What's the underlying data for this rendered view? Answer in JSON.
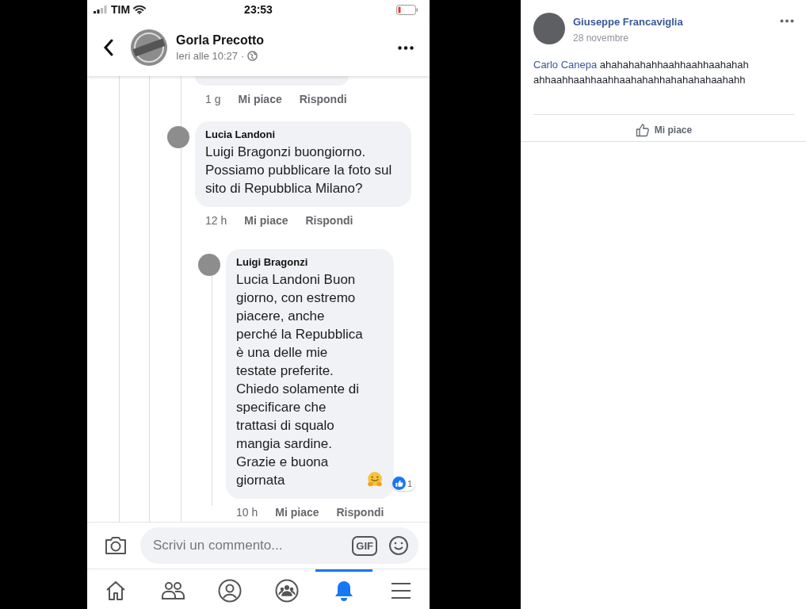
{
  "status_bar": {
    "carrier": "TIM",
    "time": "23:53"
  },
  "header": {
    "title": "Gorla Precotto",
    "subtitle": "Ieri alle 10:27 ·"
  },
  "comments": [
    {
      "kind": "cut",
      "time": "1 g",
      "like": "Mi piace",
      "reply": "Rispondi"
    },
    {
      "kind": "full",
      "author": "Lucia Landoni",
      "text": "Luigi Bragonzi buongiorno. Possiamo pubblicare la foto sul sito di Repubblica Milano?",
      "time": "12 h",
      "like": "Mi piace",
      "reply": "Rispondi",
      "children": [
        {
          "kind": "full",
          "author": "Luigi Bragonzi",
          "text": "Lucia Landoni  Buon giorno, con estremo piacere, anche perché la Repubblica è una delle mie testate preferite. Chiedo solamente di specificare che trattasi di squalo mangia sardine. Grazie e buona giornata",
          "reaction_count": "1",
          "time": "10 h",
          "like": "Mi piace",
          "reply": "Rispondi"
        }
      ]
    }
  ],
  "composer": {
    "placeholder": "Scrivi un commento...",
    "gif_label": "GIF"
  },
  "tab_bar": {
    "tabs": [
      {
        "kind": "home",
        "selected": false
      },
      {
        "kind": "friends",
        "selected": false
      },
      {
        "kind": "profile",
        "selected": false
      },
      {
        "kind": "groups",
        "selected": false
      },
      {
        "kind": "notifications",
        "selected": true
      },
      {
        "kind": "menu",
        "selected": false
      }
    ]
  },
  "post": {
    "author": "Giuseppe Francaviglia",
    "date": "28 novembre",
    "mention": "Carlo Canepa",
    "text": "ahahahahahhaahhaahhaahahah ahhaahhaahhaahhaahahahhahahahahaahahh",
    "like_label": "Mi piace"
  }
}
